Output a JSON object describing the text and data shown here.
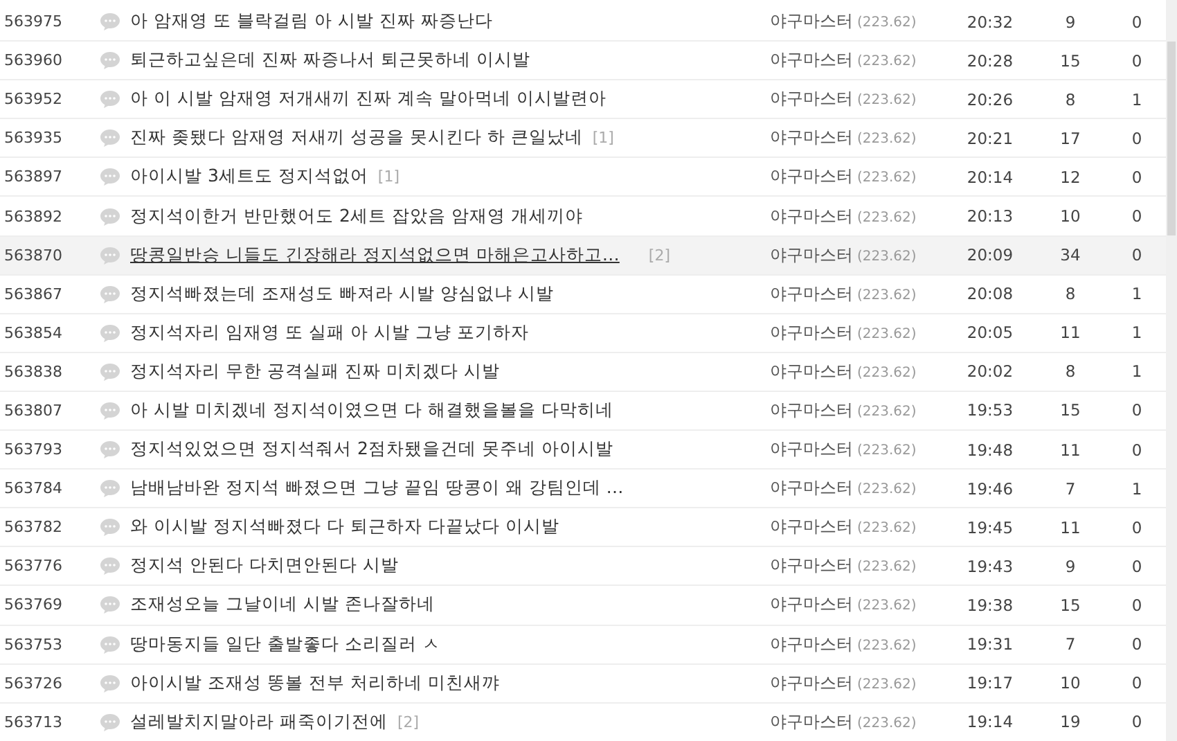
{
  "posts": [
    {
      "number": "563975",
      "title": "아 암재영 또 블락걸림 아 시발 진짜 짜증난다",
      "author": "야구마스터",
      "ip": "(223.62)",
      "time": "20:32",
      "views": "9",
      "recommends": "0",
      "selected": false
    },
    {
      "number": "563960",
      "title": "퇴근하고싶은데 진짜 짜증나서 퇴근못하네 이시발",
      "author": "야구마스터",
      "ip": "(223.62)",
      "time": "20:28",
      "views": "15",
      "recommends": "0",
      "selected": false
    },
    {
      "number": "563952",
      "title": "아 이 시발 암재영 저개새끼 진짜 계속 말아먹네 이시발련아",
      "author": "야구마스터",
      "ip": "(223.62)",
      "time": "20:26",
      "views": "8",
      "recommends": "1",
      "selected": false
    },
    {
      "number": "563935",
      "title": "진짜 좆됐다 암재영 저새끼 성공을 못시킨다 하 큰일났네",
      "comments": "[1]",
      "author": "야구마스터",
      "ip": "(223.62)",
      "time": "20:21",
      "views": "17",
      "recommends": "0",
      "selected": false
    },
    {
      "number": "563897",
      "title": "아이시발 3세트도 정지석없어",
      "comments": "[1]",
      "author": "야구마스터",
      "ip": "(223.62)",
      "time": "20:14",
      "views": "12",
      "recommends": "0",
      "selected": false
    },
    {
      "number": "563892",
      "title": "정지석이한거 반만했어도 2세트 잡았음 암재영 개세끼야",
      "author": "야구마스터",
      "ip": "(223.62)",
      "time": "20:13",
      "views": "10",
      "recommends": "0",
      "selected": false
    },
    {
      "number": "563870",
      "title": "땅콩일반승 니들도 긴장해라 정지석없으면 마해은고사하고…",
      "comments": "[2]",
      "author": "야구마스터",
      "ip": "(223.62)",
      "time": "20:09",
      "views": "34",
      "recommends": "0",
      "selected": true
    },
    {
      "number": "563867",
      "title": "정지석빠졌는데 조재성도 빠져라 시발 양심없냐 시발",
      "author": "야구마스터",
      "ip": "(223.62)",
      "time": "20:08",
      "views": "8",
      "recommends": "1",
      "selected": false
    },
    {
      "number": "563854",
      "title": "정지석자리 임재영 또 실패 아 시발 그냥 포기하자",
      "author": "야구마스터",
      "ip": "(223.62)",
      "time": "20:05",
      "views": "11",
      "recommends": "1",
      "selected": false
    },
    {
      "number": "563838",
      "title": "정지석자리 무한 공격실패 진짜 미치겠다 시발",
      "author": "야구마스터",
      "ip": "(223.62)",
      "time": "20:02",
      "views": "8",
      "recommends": "1",
      "selected": false
    },
    {
      "number": "563807",
      "title": "아 시발 미치겠네 정지석이였으면 다 해결했을볼을 다막히네",
      "author": "야구마스터",
      "ip": "(223.62)",
      "time": "19:53",
      "views": "15",
      "recommends": "0",
      "selected": false
    },
    {
      "number": "563793",
      "title": "정지석있었으면 정지석줘서 2점차됐을건데 못주네 아이시발",
      "author": "야구마스터",
      "ip": "(223.62)",
      "time": "19:48",
      "views": "11",
      "recommends": "0",
      "selected": false
    },
    {
      "number": "563784",
      "title": "남배남바완 정지석 빠졌으면 그냥 끝임 땅콩이 왜 강팀인데 …",
      "author": "야구마스터",
      "ip": "(223.62)",
      "time": "19:46",
      "views": "7",
      "recommends": "1",
      "selected": false
    },
    {
      "number": "563782",
      "title": "와 이시발 정지석빠졌다 다 퇴근하자 다끝났다 이시발",
      "author": "야구마스터",
      "ip": "(223.62)",
      "time": "19:45",
      "views": "11",
      "recommends": "0",
      "selected": false
    },
    {
      "number": "563776",
      "title": "정지석 안된다 다치면안된다 시발",
      "author": "야구마스터",
      "ip": "(223.62)",
      "time": "19:43",
      "views": "9",
      "recommends": "0",
      "selected": false
    },
    {
      "number": "563769",
      "title": "조재성오늘 그날이네 시발 존나잘하네",
      "author": "야구마스터",
      "ip": "(223.62)",
      "time": "19:38",
      "views": "15",
      "recommends": "0",
      "selected": false
    },
    {
      "number": "563753",
      "title": "땅마동지들 일단 출발좋다 소리질러 ㅅ",
      "author": "야구마스터",
      "ip": "(223.62)",
      "time": "19:31",
      "views": "7",
      "recommends": "0",
      "selected": false
    },
    {
      "number": "563726",
      "title": "아이시발 조재성 똥볼 전부 처리하네 미친새꺄",
      "author": "야구마스터",
      "ip": "(223.62)",
      "time": "19:17",
      "views": "10",
      "recommends": "0",
      "selected": false
    },
    {
      "number": "563713",
      "title": "설레발치지말아라 패죽이기전에",
      "comments": "[2]",
      "author": "야구마스터",
      "ip": "(223.62)",
      "time": "19:14",
      "views": "19",
      "recommends": "0",
      "selected": false
    }
  ]
}
